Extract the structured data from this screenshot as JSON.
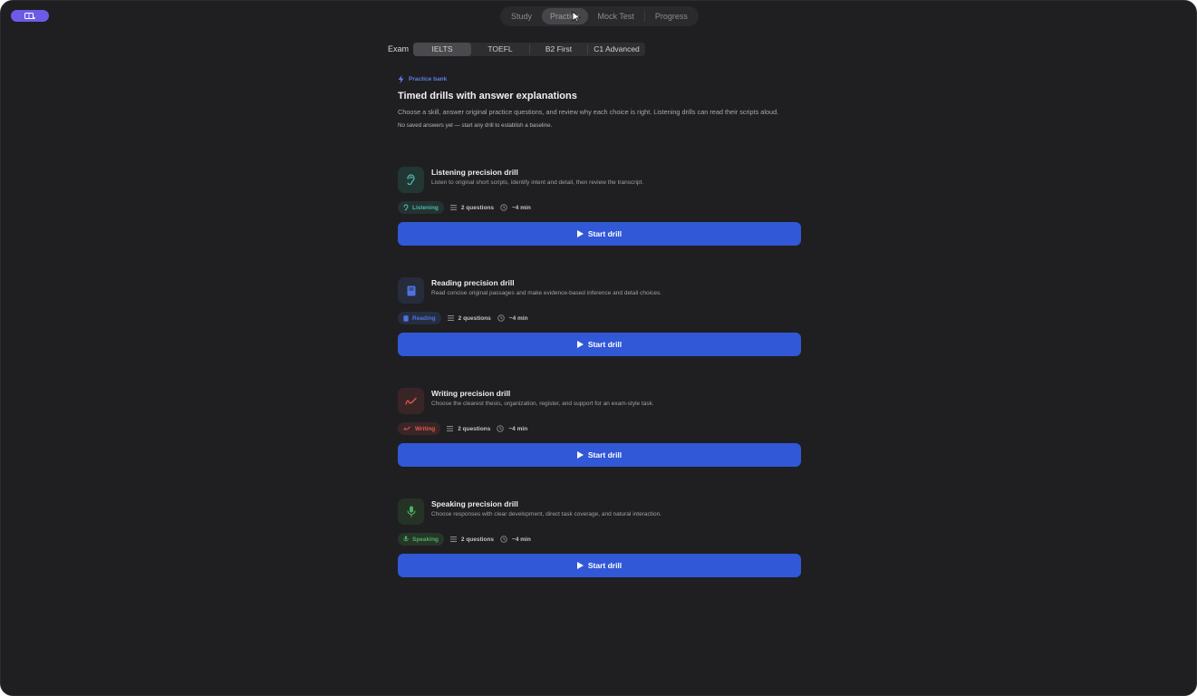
{
  "nav": {
    "tabs": [
      {
        "label": "Study"
      },
      {
        "label": "Practice"
      },
      {
        "label": "Mock Test"
      },
      {
        "label": "Progress"
      }
    ],
    "active": "Practice"
  },
  "exam": {
    "label": "Exam",
    "options": [
      "IELTS",
      "TOEFL",
      "B2 First",
      "C1 Advanced"
    ],
    "selected": "IELTS"
  },
  "header": {
    "kicker": "Practice bank",
    "title": "Timed drills with answer explanations",
    "description": "Choose a skill, answer original practice questions, and review why each choice is right. Listening drills can read their scripts aloud.",
    "note": "No saved answers yet — start any drill to establish a baseline."
  },
  "drills": [
    {
      "title": "Listening precision drill",
      "description": "Listen to original short scripts, identify intent and detail, then review the transcript.",
      "skill": "Listening",
      "icon": "ear-icon",
      "color": "#4fb6a8",
      "questions": "2 questions",
      "duration": "~4 min",
      "button": "Start drill"
    },
    {
      "title": "Reading precision drill",
      "description": "Read concise original passages and make evidence-based inference and detail choices.",
      "skill": "Reading",
      "icon": "book-icon",
      "color": "#4f72e0",
      "questions": "2 questions",
      "duration": "~4 min",
      "button": "Start drill"
    },
    {
      "title": "Writing precision drill",
      "description": "Choose the clearest thesis, organization, register, and support for an exam-style task.",
      "skill": "Writing",
      "icon": "pen-icon",
      "color": "#e0584f",
      "questions": "2 questions",
      "duration": "~4 min",
      "button": "Start drill"
    },
    {
      "title": "Speaking precision drill",
      "description": "Choose responses with clear development, direct task coverage, and natural interaction.",
      "skill": "Speaking",
      "icon": "microphone-icon",
      "color": "#4caf63",
      "questions": "2 questions",
      "duration": "~4 min",
      "button": "Start drill"
    }
  ]
}
